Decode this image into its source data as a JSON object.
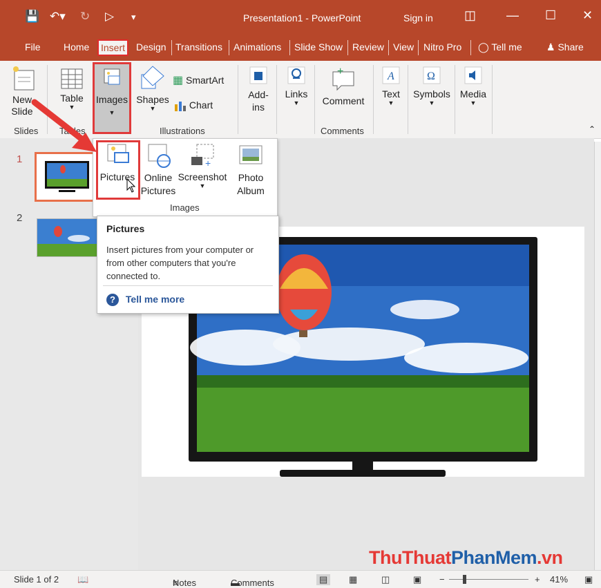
{
  "titlebar": {
    "title": "Presentation1  -  PowerPoint",
    "signin": "Sign in",
    "colors": {
      "accent": "#b7472a",
      "highlight": "#e03a3a"
    }
  },
  "tabs": [
    {
      "label": "File"
    },
    {
      "label": "Home"
    },
    {
      "label": "Insert"
    },
    {
      "label": "Design"
    },
    {
      "label": "Transitions"
    },
    {
      "label": "Animations"
    },
    {
      "label": "Slide Show"
    },
    {
      "label": "Review"
    },
    {
      "label": "View"
    },
    {
      "label": "Nitro Pro"
    },
    {
      "label": "Tell me"
    },
    {
      "label": "Share"
    }
  ],
  "ribbon": {
    "new_slide": "New Slide",
    "table": "Table",
    "images": "Images",
    "shapes": "Shapes",
    "smartart": "SmartArt",
    "chart": "Chart",
    "addins": "Add-ins",
    "links": "Links",
    "comment": "Comment",
    "text": "Text",
    "symbols": "Symbols",
    "media": "Media",
    "groups": {
      "slides": "Slides",
      "tables": "Tables",
      "illustrations": "Illustrations",
      "comments": "Comments"
    }
  },
  "images_menu": {
    "pictures": "Pictures",
    "online_pictures": "Online Pictures",
    "screenshot": "Screenshot",
    "photo_album": "Photo Album",
    "group_label": "Images"
  },
  "tooltip": {
    "title": "Pictures",
    "body": "Insert pictures from your computer or from other computers that you're connected to.",
    "link": "Tell me more"
  },
  "thumbnails": [
    {
      "number": "1"
    },
    {
      "number": "2"
    }
  ],
  "statusbar": {
    "slide_info": "Slide 1 of 2",
    "notes": "Notes",
    "comments": "Comments",
    "zoom": "41%"
  },
  "watermark": {
    "part1": "ThuThuat",
    "part2": "PhanMem",
    "part3": ".vn"
  }
}
